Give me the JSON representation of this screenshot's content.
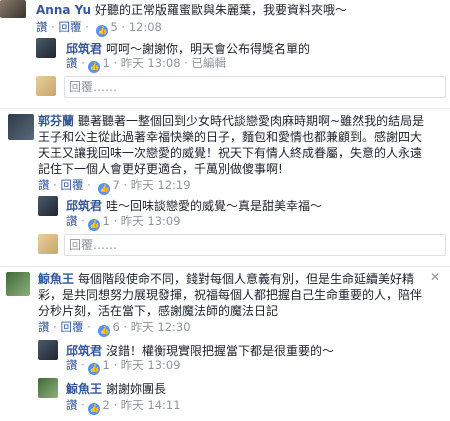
{
  "comments": [
    {
      "name": "Anna Yu",
      "text": "好聽的正常版羅蜜歐與朱麗葉，我要資料夾哦～",
      "meta": {
        "reply": "回覆",
        "likes": "5",
        "time": "12:08"
      }
    },
    {
      "name": "邱筑君",
      "text": "呵呵～謝謝你，明天會公布得獎名單的",
      "meta": {
        "like": "讚",
        "reply": "1",
        "time": "昨天 13:08",
        "edited": "已編輯"
      }
    },
    {
      "reply_placeholder": "回覆……"
    },
    {
      "name": "郭芬蘭",
      "text_lines": [
        "聽著聽著一整個回到少女時代談戀愛肉麻時期啊~雖然我的結局是",
        "王子和公主從此過著幸福快樂的日子，麵包和愛情也都兼顧到。感謝四大",
        "天王又讓我回味一次戀愛的威覺！祝天下有情人終成眷屬，失意的人永遠",
        "記住下一個人會更好更適合，千萬別做傻事啊!"
      ],
      "meta": {
        "like": "讚",
        "reply": "回覆",
        "likes": "7",
        "time": "昨天 12:19"
      }
    },
    {
      "name": "邱筑君",
      "text": "哇～回味談戀愛的威覺～真是甜美幸福～",
      "meta": {
        "like": "讚",
        "reply": "1",
        "time": "昨天 13:09"
      }
    },
    {
      "reply_placeholder": "回覆……"
    },
    {
      "name": "鯨魚王",
      "text_lines": [
        "每個階段使命不同，錢對每個人意義有別，但是生命延續美好精",
        "彩，是共同想努力展現發揮，祝福每個人都把握自己生命重要的人，陪伴",
        "分秒片刻，活在當下，感謝魔法師的魔法日記"
      ],
      "meta": {
        "like": "讚",
        "reply": "回覆",
        "likes": "6",
        "time": "昨天 12:30"
      }
    },
    {
      "name": "邱筑君",
      "text": "沒錯！權衡現實限把握當下都是很重要的～",
      "meta": {
        "like": "讚",
        "reply": "1",
        "time": "昨天 13:09"
      }
    },
    {
      "name": "鯨魚王",
      "text": "謝謝妳團長",
      "meta": {
        "like": "讚",
        "likes": "2",
        "time": "昨天 14:11"
      }
    }
  ],
  "icons": {
    "like": "thumbs-up-icon",
    "close": "close-icon"
  },
  "colors": {
    "link": "#365899",
    "meta": "#90949c",
    "like_badge": "#5890ff"
  }
}
